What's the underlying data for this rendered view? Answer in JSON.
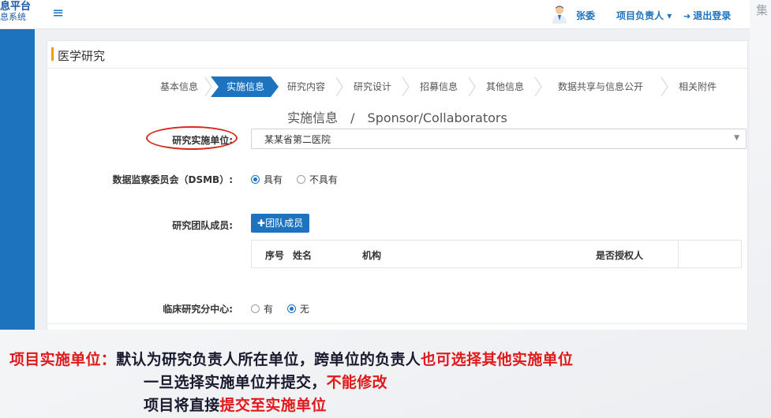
{
  "header": {
    "brand_line1": "息平台",
    "brand_line2": "息系统",
    "user_name": "张委",
    "role_menu": "项目负责人",
    "logout": "退出登录",
    "edge_char": "集"
  },
  "panel": {
    "title": "医学研究",
    "steps": [
      "基本信息",
      "实施信息",
      "研究内容",
      "研究设计",
      "招募信息",
      "其他信息",
      "数据共享与信息公开",
      "相关附件"
    ],
    "active_step_index": 1,
    "section_title": "实施信息　/　Sponsor/Collaborators"
  },
  "form": {
    "unit_label": "研究实施单位:",
    "unit_value": "某某省第二医院",
    "dsmb_label": "数据监察委员会（DSMB）:",
    "dsmb_options": [
      "具有",
      "不具有"
    ],
    "dsmb_selected": "具有",
    "team_label": "研究团队成员:",
    "add_member_label": "团队成员",
    "table_headers": [
      "序号",
      "姓名",
      "机构",
      "是否授权人"
    ],
    "subcenter_label": "临床研究分中心:",
    "subcenter_options": [
      "有",
      "无"
    ],
    "subcenter_selected": "无"
  },
  "caption": {
    "line1_a": "项目实施单位：",
    "line1_b": "默认为研究负责人所在单位，跨单位的负责人",
    "line1_c": "也可选择其他实施单位",
    "line2_a": "一旦选择实施单位并提交，",
    "line2_b": "不能修改",
    "line3_a": "项目将直接",
    "line3_b": "提交至实施单位"
  },
  "colors": {
    "primary": "#1e73be",
    "accent_bar": "#f39c12",
    "highlight_red": "#e0191b"
  }
}
